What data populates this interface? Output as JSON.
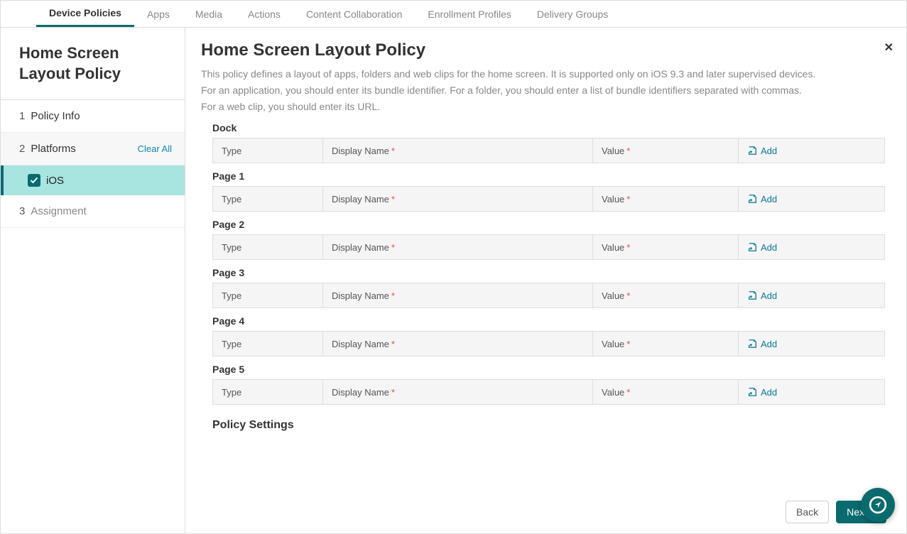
{
  "tabs": {
    "device_policies": "Device Policies",
    "apps": "Apps",
    "media": "Media",
    "actions": "Actions",
    "content_collaboration": "Content Collaboration",
    "enrollment_profiles": "Enrollment Profiles",
    "delivery_groups": "Delivery Groups"
  },
  "sidebar": {
    "title": "Home Screen Layout Policy",
    "step1_num": "1",
    "step1_label": "Policy Info",
    "step2_num": "2",
    "step2_label": "Platforms",
    "clear_all": "Clear All",
    "platform_ios": "iOS",
    "step3_num": "3",
    "step3_label": "Assignment"
  },
  "main": {
    "title": "Home Screen Layout Policy",
    "desc_line1": "This policy defines a layout of apps, folders and web clips for the home screen. It is supported only on iOS 9.3 and later supervised devices.",
    "desc_line2": "For an application, you should enter its bundle identifier. For a folder, you should enter a list of bundle identifiers separated with commas.",
    "desc_line3": "For a web clip, you should enter its URL.",
    "columns": {
      "type": "Type",
      "display_name": "Display Name",
      "value": "Value",
      "add": "Add"
    },
    "sections": {
      "dock": "Dock",
      "page1": "Page 1",
      "page2": "Page 2",
      "page3": "Page 3",
      "page4": "Page 4",
      "page5": "Page 5"
    },
    "settings_heading": "Policy Settings"
  },
  "buttons": {
    "back": "Back",
    "next": "Next >"
  }
}
